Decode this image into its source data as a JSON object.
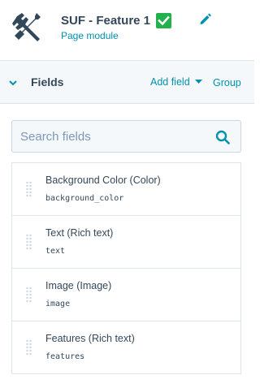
{
  "header": {
    "icon": "wrench-screwdriver-icon",
    "title": "SUF - Feature 1",
    "status_icon": "checkmark-icon",
    "status_color": "#22b14c",
    "subtitle": "Page module",
    "edit_icon": "pencil-icon"
  },
  "fields_panel": {
    "title": "Fields",
    "add_field_label": "Add field",
    "group_label": "Group"
  },
  "search": {
    "placeholder": "Search fields",
    "value": ""
  },
  "fields": [
    {
      "label": "Background Color (Color)",
      "name": "background_color"
    },
    {
      "label": "Text (Rich text)",
      "name": "text"
    },
    {
      "label": "Image (Image)",
      "name": "image"
    },
    {
      "label": "Features (Rich text)",
      "name": "features"
    }
  ],
  "colors": {
    "accent": "#0091ae",
    "text": "#33475b",
    "panel_bg": "#f5f8fa",
    "border": "#dfe3eb"
  }
}
